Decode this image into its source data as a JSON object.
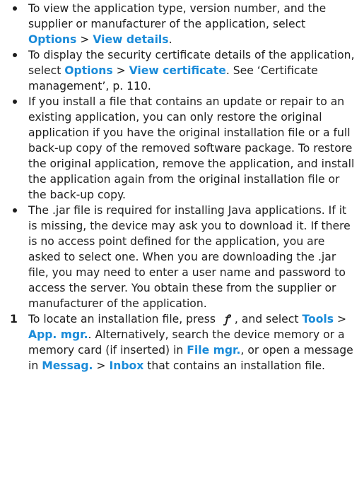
{
  "bullets": [
    {
      "parts": [
        {
          "t": "To view the application type, version number, and the supplier or manufacturer of the application, select "
        },
        {
          "t": "Options",
          "link": true
        },
        {
          "t": " > "
        },
        {
          "t": "View details",
          "link": true
        },
        {
          "t": "."
        }
      ]
    },
    {
      "parts": [
        {
          "t": "To display the security certificate details of the application, select "
        },
        {
          "t": "Options",
          "link": true
        },
        {
          "t": " > "
        },
        {
          "t": "View certificate",
          "link": true
        },
        {
          "t": ". See ‘Certificate management’, p. 110."
        }
      ]
    },
    {
      "parts": [
        {
          "t": "If you install a file that contains an update or repair to an existing application, you can only restore the original application if you have the original installation file or a full back-up copy of the removed software package. To restore the original application, remove the application, and install the application again from the original installation file or the back-up copy."
        }
      ]
    },
    {
      "parts": [
        {
          "t": "The .jar file is required for installing Java applications. If it is missing, the device may ask you to download it. If there is no access point defined for the application, you are asked to select one. When you are downloading the .jar file, you may need to enter a user name and password to access the server. You obtain these from the supplier or manufacturer of the application."
        }
      ]
    }
  ],
  "step": {
    "number": "1",
    "parts": [
      {
        "t": "To locate an installation file, press "
      },
      {
        "icon": "menu-key-icon",
        "glyph": "ꝭ"
      },
      {
        "t": ", and select "
      },
      {
        "t": "Tools",
        "link": true
      },
      {
        "t": " > "
      },
      {
        "t": "App. mgr.",
        "link": true
      },
      {
        "t": ". Alternatively, search the device memory or a memory card (if inserted) in "
      },
      {
        "t": "File mgr.",
        "link": true
      },
      {
        "t": ", or open a message in "
      },
      {
        "t": "Messag.",
        "link": true
      },
      {
        "t": " > "
      },
      {
        "t": "Inbox",
        "link": true
      },
      {
        "t": " that contains an installation file."
      }
    ]
  },
  "colors": {
    "link": "#1a8bd9",
    "text": "#1e1e1e"
  }
}
